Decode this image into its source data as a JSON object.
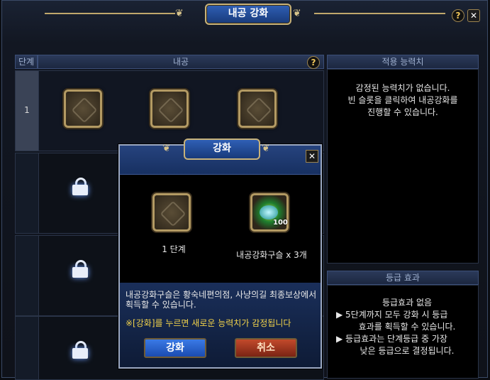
{
  "window": {
    "title": "내공 강화"
  },
  "header": {
    "stage": "단계",
    "neigong": "내공",
    "applied": "적용 능력치",
    "grade": "등급 효과"
  },
  "rows": [
    {
      "stage": "1"
    },
    {
      "stage": ""
    },
    {
      "stage": ""
    },
    {
      "stage": ""
    }
  ],
  "applied_panel": {
    "line1": "감정된 능력치가 없습니다.",
    "line2": "빈 슬롯을 클릭하여 내공강화를",
    "line3": "진행할 수 있습니다."
  },
  "grade_panel": {
    "line1": "등급효과 없음",
    "line2": "▶ 5단계까지 모두 강화 시 등급",
    "line3": "효과를 획득할 수 있습니다.",
    "line4": "▶ 등급효과는 단계등급 중 가장",
    "line5": "낮은 등급으로 결정됩니다."
  },
  "modal": {
    "title": "강화",
    "item1_label": "1 단계",
    "item2_label": "내공강화구슬 x 3개",
    "item2_qty": "100",
    "info1": "내공강화구슬은 황숙네편의점, 사냥의길 최종보상에서 획득할 수 있습니다.",
    "info2": "※[강화]를 누르면 새로운 능력치가 감정됩니다",
    "ok_label": "강화",
    "cancel_label": "취소"
  },
  "icons": {
    "help": "?",
    "close": "✕"
  }
}
